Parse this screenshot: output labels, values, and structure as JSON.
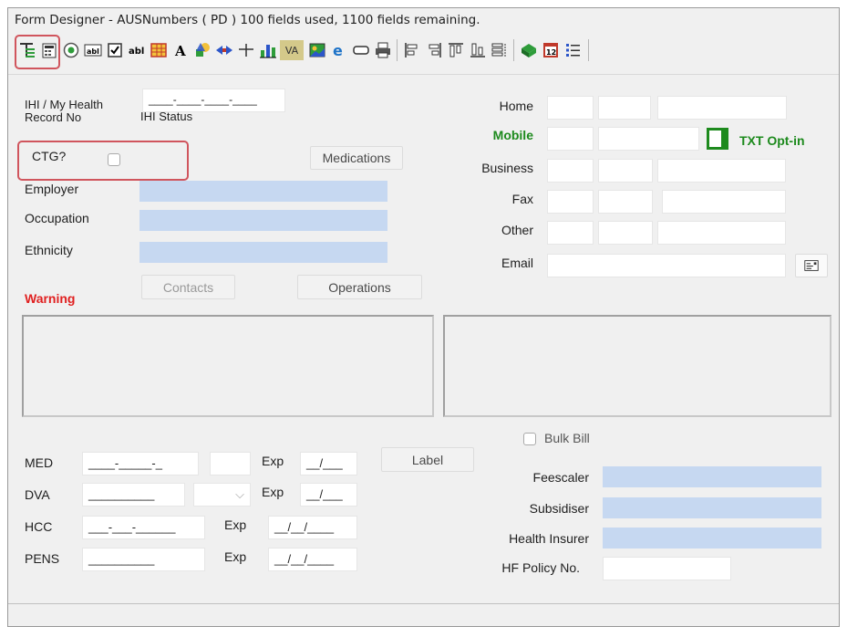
{
  "window": {
    "title": "Form Designer - AUSNumbers ( PD ) 100 fields used, 1100 fields remaining."
  },
  "toolbar": {
    "va_label": "VA"
  },
  "form": {
    "ihi_label": "IHI / My Health Record No",
    "ihi_value": "____-____-____-____",
    "ihi_status_label": "IHI Status",
    "ctg_label": "CTG?",
    "medications_button": "Medications",
    "employer_label": "Employer",
    "occupation_label": "Occupation",
    "ethnicity_label": "Ethnicity",
    "contacts_button": "Contacts",
    "operations_button": "Operations",
    "warning_label": "Warning",
    "home_label": "Home",
    "mobile_label": "Mobile",
    "txt_optin_label": "TXT Opt-in",
    "business_label": "Business",
    "fax_label": "Fax",
    "other_label": "Other",
    "email_label": "Email",
    "med_label": "MED",
    "med_value": "____-_____-_",
    "dva_label": "DVA",
    "dva_value": "__________",
    "hcc_label": "HCC",
    "hcc_value": "___-___-______",
    "pens_label": "PENS",
    "pens_value": "__________",
    "exp_label": "Exp",
    "exp_short_value": "__/___",
    "exp_long_value": "__/__/____",
    "label_button": "Label",
    "bulk_bill_label": "Bulk Bill",
    "feescaler_label": "Feescaler",
    "subsidiser_label": "Subsidiser",
    "health_insurer_label": "Health Insurer",
    "hf_policy_label": "HF Policy No."
  },
  "colors": {
    "accent_green": "#1d8a1d",
    "warning_red": "#e02020",
    "highlight_box": "#d0555d",
    "blue_field": "#c6d8f1"
  },
  "icons": [
    "tree-icon",
    "calculator-icon",
    "radio-button-icon",
    "textbox-icon",
    "checkbox-icon",
    "label-icon",
    "grid-icon",
    "font-icon",
    "shapes-icon",
    "arrows-icon",
    "line-icon",
    "bar-chart-icon",
    "variable-icon",
    "image-icon",
    "browser-icon",
    "button-icon",
    "print-icon",
    "align-left-icon",
    "align-right-icon",
    "align-top-icon",
    "align-bottom-icon",
    "distribute-icon",
    "book-icon",
    "calendar-icon",
    "list-icon"
  ]
}
